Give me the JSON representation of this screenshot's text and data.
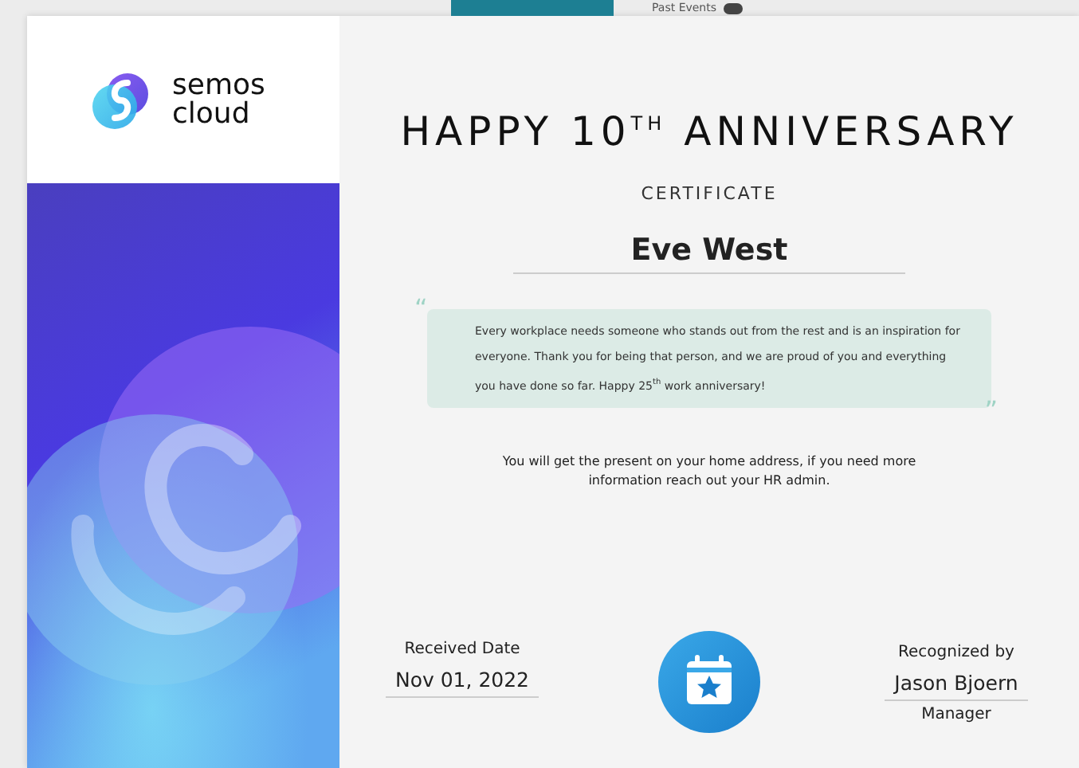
{
  "background_strip": {
    "label": "Past Events"
  },
  "brand": {
    "line_1": "semos",
    "line_2": "cloud"
  },
  "certificate": {
    "title": "HAPPY 10$^{TH}$ ANNIVERSARY",
    "subtitle": "CERTIFICATE",
    "recipient": "Eve West",
    "quote": "Every workplace needs someone who stands out from the rest and is an inspiration for everyone. Thank you for being that person, and we are proud of you and everything you have done so far. Happy 25$^{th}$ work anniversary!",
    "open_quote": "“",
    "close_quote": "”",
    "note": "You will get the present on your home address, if you need more information reach out your HR admin.",
    "received": {
      "label": "Received Date",
      "value": "Nov 01, 2022"
    },
    "recognized": {
      "label": "Recognized by",
      "value": "Jason Bjoern",
      "role": "Manager"
    }
  }
}
